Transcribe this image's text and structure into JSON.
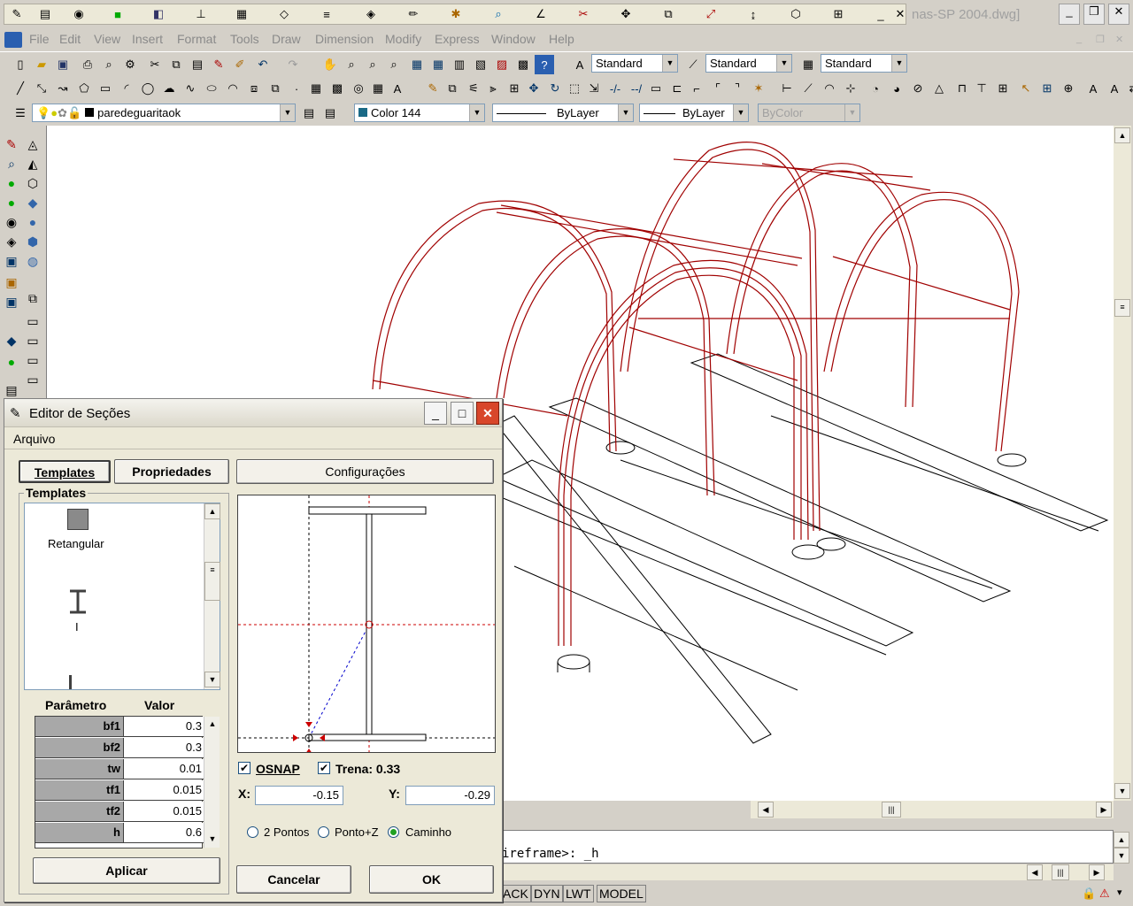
{
  "window": {
    "title_fragment": "nas-SP 2004.dwg]"
  },
  "menu": [
    "File",
    "Edit",
    "View",
    "Insert",
    "Format",
    "Tools",
    "Draw",
    "Dimension",
    "Modify",
    "Express",
    "Window",
    "Help"
  ],
  "styles": {
    "text_style": "Standard",
    "dim_style": "Standard",
    "table_style": "Standard"
  },
  "layers": {
    "current_layer": "paredeguaritaok",
    "color": "Color 144",
    "linetype": "ByLayer",
    "lineweight": "ByLayer",
    "plotstyle": "ByColor"
  },
  "command": {
    "line1": "ireframe>: _h"
  },
  "status": {
    "ack": "ACK",
    "dyn": "DYN",
    "lwt": "LWT",
    "model": "MODEL"
  },
  "dialog": {
    "title": "Editor de Seções",
    "menu": "Arquivo",
    "tab_templates": "Templates",
    "tab_propriedades": "Propriedades",
    "config_button": "Configurações",
    "group_label": "Templates",
    "templates": [
      {
        "label": "Retangular"
      },
      {
        "label": "I"
      }
    ],
    "param_header": "Parâmetro",
    "value_header": "Valor",
    "params": [
      {
        "name": "bf1",
        "value": "0.3"
      },
      {
        "name": "bf2",
        "value": "0.3"
      },
      {
        "name": "tw",
        "value": "0.01"
      },
      {
        "name": "tf1",
        "value": "0.015"
      },
      {
        "name": "tf2",
        "value": "0.015"
      },
      {
        "name": "h",
        "value": "0.6"
      }
    ],
    "apply_button": "Aplicar",
    "osnap_label": "OSNAP",
    "trena_label": "Trena: 0.33",
    "x_label": "X:",
    "x_value": "-0.15",
    "y_label": "Y:",
    "y_value": "-0.29",
    "radio_2pontos": "2 Pontos",
    "radio_pontoz": "Ponto+Z",
    "radio_caminho": "Caminho",
    "cancel_button": "Cancelar",
    "ok_button": "OK"
  }
}
